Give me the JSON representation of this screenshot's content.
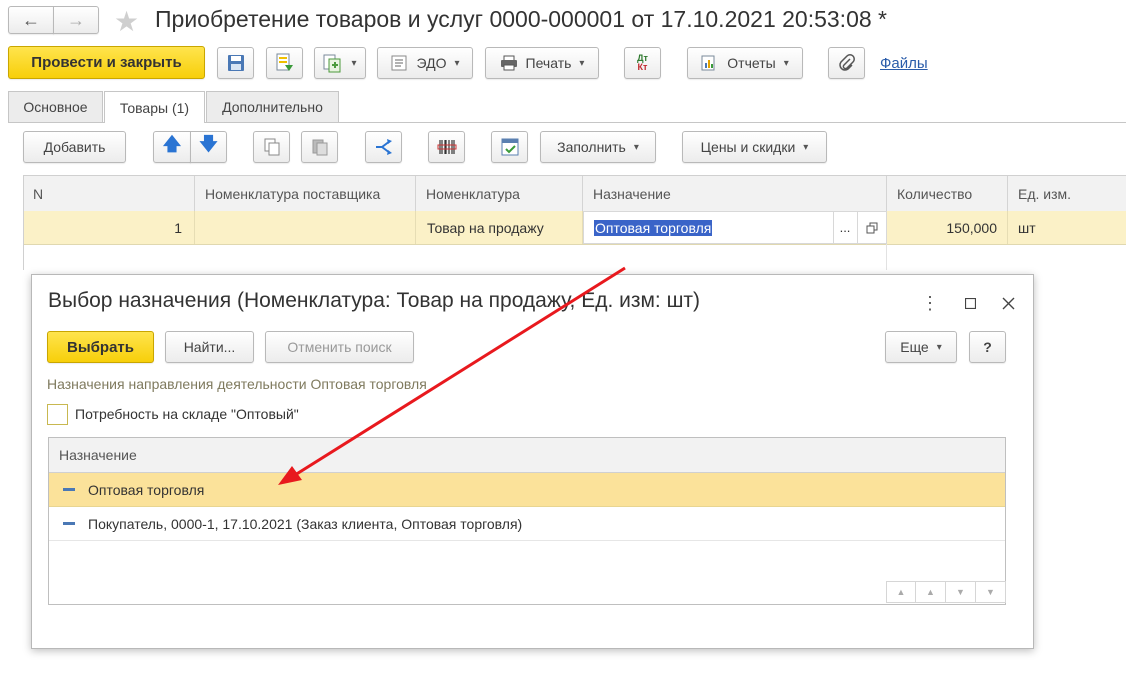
{
  "window": {
    "title": "Приобретение товаров и услуг 0000-000001 от 17.10.2021 20:53:08 *"
  },
  "toolbar": {
    "post_close_label": "Провести и закрыть",
    "edo_label": "ЭДО",
    "print_label": "Печать",
    "reports_label": "Отчеты",
    "files_label": "Файлы",
    "dtkt_top": "Дт",
    "dtkt_bottom": "Кт"
  },
  "tabs": [
    {
      "label": "Основное"
    },
    {
      "label": "Товары (1)"
    },
    {
      "label": "Дополнительно"
    }
  ],
  "goods_toolbar": {
    "add_label": "Добавить",
    "fill_label": "Заполнить",
    "prices_label": "Цены и скидки"
  },
  "grid": {
    "columns": [
      "N",
      "Номенклатура поставщика",
      "Номенклатура",
      "Назначение",
      "Количество",
      "Ед. изм."
    ],
    "rows": [
      {
        "n": "1",
        "supplier_item": "",
        "item": "Товар на продажу",
        "purpose": "Оптовая торговля",
        "qty": "150,000",
        "unit": "шт",
        "ellipsis": "..."
      }
    ]
  },
  "dialog": {
    "title": "Выбор назначения (Номенклатура: Товар на продажу, Ед. изм: шт)",
    "select_label": "Выбрать",
    "find_label": "Найти...",
    "cancel_search_label": "Отменить поиск",
    "more_label": "Еще",
    "help_label": "?",
    "info_text": "Назначения направления деятельности Оптовая торговля",
    "checkbox_label": "Потребность на складе \"Оптовый\"",
    "list_header": "Назначение",
    "list_items": [
      {
        "label": "Оптовая торговля"
      },
      {
        "label": "Покупатель, 0000-1, 17.10.2021 (Заказ клиента, Оптовая торговля)"
      }
    ]
  },
  "colors": {
    "accent_yellow": "#f7cf0a",
    "selected_row": "#fbe29a",
    "arrow_red": "#e8191e",
    "link_blue": "#2a5caa"
  }
}
